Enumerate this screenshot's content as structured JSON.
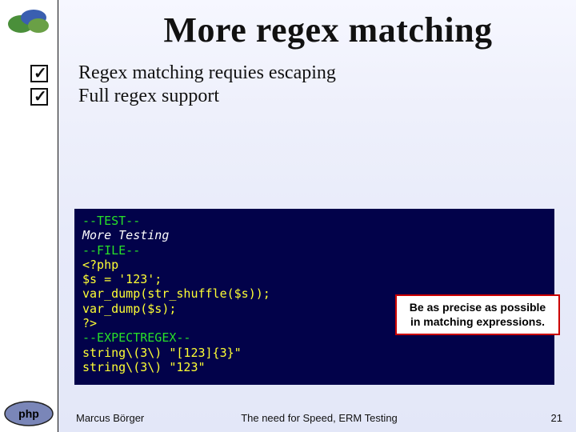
{
  "title": "More regex matching",
  "bullets": [
    "Regex matching requies escaping",
    "Full regex support"
  ],
  "code": {
    "l1": "--TEST--",
    "l2": "More Testing",
    "l3": "--FILE--",
    "l4": "<?php",
    "l5": "$s = '123';",
    "l6": "var_dump(str_shuffle($s));",
    "l7": "var_dump($s);",
    "l8": "?>",
    "l9": "--EXPECTREGEX--",
    "l10": "string\\(3\\) \"[123]{3}\"",
    "l11": "string\\(3\\) \"123\""
  },
  "callout": "Be as precise as possible in matching expressions.",
  "footer": {
    "author": "Marcus Börger",
    "center": "The need for Speed, ERM Testing",
    "page": "21"
  }
}
